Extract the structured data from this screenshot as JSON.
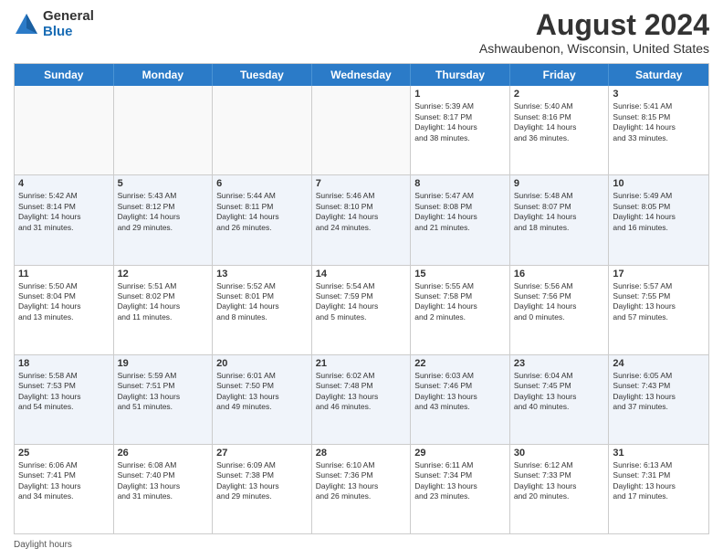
{
  "header": {
    "logo_general": "General",
    "logo_blue": "Blue",
    "title": "August 2024",
    "subtitle": "Ashwaubenon, Wisconsin, United States"
  },
  "calendar": {
    "days_of_week": [
      "Sunday",
      "Monday",
      "Tuesday",
      "Wednesday",
      "Thursday",
      "Friday",
      "Saturday"
    ],
    "weeks": [
      [
        {
          "day": "",
          "empty": true
        },
        {
          "day": "",
          "empty": true
        },
        {
          "day": "",
          "empty": true
        },
        {
          "day": "",
          "empty": true
        },
        {
          "day": "1",
          "lines": [
            "Sunrise: 5:39 AM",
            "Sunset: 8:17 PM",
            "Daylight: 14 hours",
            "and 38 minutes."
          ]
        },
        {
          "day": "2",
          "lines": [
            "Sunrise: 5:40 AM",
            "Sunset: 8:16 PM",
            "Daylight: 14 hours",
            "and 36 minutes."
          ]
        },
        {
          "day": "3",
          "lines": [
            "Sunrise: 5:41 AM",
            "Sunset: 8:15 PM",
            "Daylight: 14 hours",
            "and 33 minutes."
          ]
        }
      ],
      [
        {
          "day": "4",
          "lines": [
            "Sunrise: 5:42 AM",
            "Sunset: 8:14 PM",
            "Daylight: 14 hours",
            "and 31 minutes."
          ]
        },
        {
          "day": "5",
          "lines": [
            "Sunrise: 5:43 AM",
            "Sunset: 8:12 PM",
            "Daylight: 14 hours",
            "and 29 minutes."
          ]
        },
        {
          "day": "6",
          "lines": [
            "Sunrise: 5:44 AM",
            "Sunset: 8:11 PM",
            "Daylight: 14 hours",
            "and 26 minutes."
          ]
        },
        {
          "day": "7",
          "lines": [
            "Sunrise: 5:46 AM",
            "Sunset: 8:10 PM",
            "Daylight: 14 hours",
            "and 24 minutes."
          ]
        },
        {
          "day": "8",
          "lines": [
            "Sunrise: 5:47 AM",
            "Sunset: 8:08 PM",
            "Daylight: 14 hours",
            "and 21 minutes."
          ]
        },
        {
          "day": "9",
          "lines": [
            "Sunrise: 5:48 AM",
            "Sunset: 8:07 PM",
            "Daylight: 14 hours",
            "and 18 minutes."
          ]
        },
        {
          "day": "10",
          "lines": [
            "Sunrise: 5:49 AM",
            "Sunset: 8:05 PM",
            "Daylight: 14 hours",
            "and 16 minutes."
          ]
        }
      ],
      [
        {
          "day": "11",
          "lines": [
            "Sunrise: 5:50 AM",
            "Sunset: 8:04 PM",
            "Daylight: 14 hours",
            "and 13 minutes."
          ]
        },
        {
          "day": "12",
          "lines": [
            "Sunrise: 5:51 AM",
            "Sunset: 8:02 PM",
            "Daylight: 14 hours",
            "and 11 minutes."
          ]
        },
        {
          "day": "13",
          "lines": [
            "Sunrise: 5:52 AM",
            "Sunset: 8:01 PM",
            "Daylight: 14 hours",
            "and 8 minutes."
          ]
        },
        {
          "day": "14",
          "lines": [
            "Sunrise: 5:54 AM",
            "Sunset: 7:59 PM",
            "Daylight: 14 hours",
            "and 5 minutes."
          ]
        },
        {
          "day": "15",
          "lines": [
            "Sunrise: 5:55 AM",
            "Sunset: 7:58 PM",
            "Daylight: 14 hours",
            "and 2 minutes."
          ]
        },
        {
          "day": "16",
          "lines": [
            "Sunrise: 5:56 AM",
            "Sunset: 7:56 PM",
            "Daylight: 14 hours",
            "and 0 minutes."
          ]
        },
        {
          "day": "17",
          "lines": [
            "Sunrise: 5:57 AM",
            "Sunset: 7:55 PM",
            "Daylight: 13 hours",
            "and 57 minutes."
          ]
        }
      ],
      [
        {
          "day": "18",
          "lines": [
            "Sunrise: 5:58 AM",
            "Sunset: 7:53 PM",
            "Daylight: 13 hours",
            "and 54 minutes."
          ]
        },
        {
          "day": "19",
          "lines": [
            "Sunrise: 5:59 AM",
            "Sunset: 7:51 PM",
            "Daylight: 13 hours",
            "and 51 minutes."
          ]
        },
        {
          "day": "20",
          "lines": [
            "Sunrise: 6:01 AM",
            "Sunset: 7:50 PM",
            "Daylight: 13 hours",
            "and 49 minutes."
          ]
        },
        {
          "day": "21",
          "lines": [
            "Sunrise: 6:02 AM",
            "Sunset: 7:48 PM",
            "Daylight: 13 hours",
            "and 46 minutes."
          ]
        },
        {
          "day": "22",
          "lines": [
            "Sunrise: 6:03 AM",
            "Sunset: 7:46 PM",
            "Daylight: 13 hours",
            "and 43 minutes."
          ]
        },
        {
          "day": "23",
          "lines": [
            "Sunrise: 6:04 AM",
            "Sunset: 7:45 PM",
            "Daylight: 13 hours",
            "and 40 minutes."
          ]
        },
        {
          "day": "24",
          "lines": [
            "Sunrise: 6:05 AM",
            "Sunset: 7:43 PM",
            "Daylight: 13 hours",
            "and 37 minutes."
          ]
        }
      ],
      [
        {
          "day": "25",
          "lines": [
            "Sunrise: 6:06 AM",
            "Sunset: 7:41 PM",
            "Daylight: 13 hours",
            "and 34 minutes."
          ]
        },
        {
          "day": "26",
          "lines": [
            "Sunrise: 6:08 AM",
            "Sunset: 7:40 PM",
            "Daylight: 13 hours",
            "and 31 minutes."
          ]
        },
        {
          "day": "27",
          "lines": [
            "Sunrise: 6:09 AM",
            "Sunset: 7:38 PM",
            "Daylight: 13 hours",
            "and 29 minutes."
          ]
        },
        {
          "day": "28",
          "lines": [
            "Sunrise: 6:10 AM",
            "Sunset: 7:36 PM",
            "Daylight: 13 hours",
            "and 26 minutes."
          ]
        },
        {
          "day": "29",
          "lines": [
            "Sunrise: 6:11 AM",
            "Sunset: 7:34 PM",
            "Daylight: 13 hours",
            "and 23 minutes."
          ]
        },
        {
          "day": "30",
          "lines": [
            "Sunrise: 6:12 AM",
            "Sunset: 7:33 PM",
            "Daylight: 13 hours",
            "and 20 minutes."
          ]
        },
        {
          "day": "31",
          "lines": [
            "Sunrise: 6:13 AM",
            "Sunset: 7:31 PM",
            "Daylight: 13 hours",
            "and 17 minutes."
          ]
        }
      ]
    ]
  },
  "footer": {
    "text": "Daylight hours"
  }
}
